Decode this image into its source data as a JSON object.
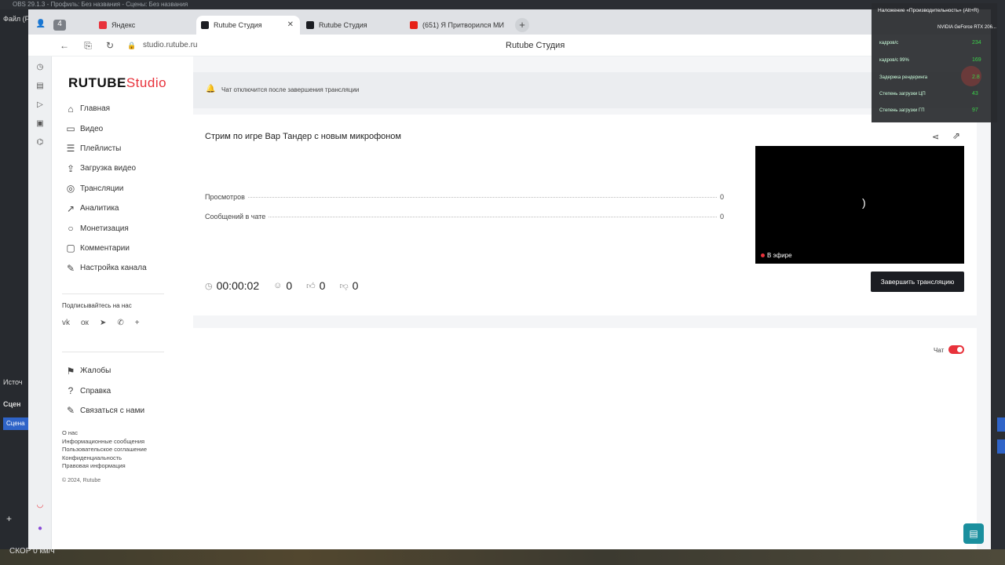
{
  "obs": {
    "title": "OBS 29.1.3 - Профиль: Без названия - Сцены: Без названия",
    "menu": "Файл (F)",
    "sources_label": "Источ",
    "scenes_label": "Сцен",
    "scene_button": "Сцена",
    "bottom_text": "СКОР 0 км/ч"
  },
  "browser": {
    "tabs": [
      {
        "label": "Яндекс",
        "active": false
      },
      {
        "label": "Rutube Студия",
        "active": true,
        "close": "✕"
      },
      {
        "label": "Rutube Студия",
        "active": false
      },
      {
        "label": "(651) Я Притворился МИ",
        "active": false
      }
    ],
    "newtab": "+",
    "url": "studio.rutube.ru",
    "page_title": "Rutube Студия"
  },
  "app": {
    "logo_main": "RUTUBE",
    "logo_accent": "Studio",
    "nav": [
      {
        "label": "Главная",
        "icon": "home-icon"
      },
      {
        "label": "Видео",
        "icon": "video-icon"
      },
      {
        "label": "Плейлисты",
        "icon": "playlist-icon"
      },
      {
        "label": "Загрузка видео",
        "icon": "upload-icon"
      },
      {
        "label": "Трансляции",
        "icon": "broadcast-icon"
      },
      {
        "label": "Аналитика",
        "icon": "analytics-icon"
      },
      {
        "label": "Монетизация",
        "icon": "monetization-icon"
      },
      {
        "label": "Комментарии",
        "icon": "comments-icon"
      },
      {
        "label": "Настройка канала",
        "icon": "settings-icon"
      }
    ],
    "follow_label": "Подписывайтесь на нас",
    "nav2": [
      {
        "label": "Жалобы",
        "icon": "flag-icon"
      },
      {
        "label": "Справка",
        "icon": "help-icon"
      },
      {
        "label": "Связаться с нами",
        "icon": "contact-icon"
      }
    ],
    "footer_links": [
      "О нас",
      "Информационные сообщения",
      "Пользовательское соглашение",
      "Конфиденциальность",
      "Правовая информация"
    ],
    "copyright": "© 2024, Rutube"
  },
  "main": {
    "notice": "Чат отключится после завершения трансляции",
    "stream_title": "Стрим по игре Вар Тандер с новым микрофоном",
    "stats": [
      {
        "label": "Просмотров",
        "value": "0"
      },
      {
        "label": "Сообщений в чате",
        "value": "0"
      }
    ],
    "live_label": "В эфире",
    "duration": "00:00:02",
    "viewers": "0",
    "likes": "0",
    "dislikes": "0",
    "end_button": "Завершить трансляцию",
    "chat_label": "Чат",
    "chat_enabled": true
  },
  "overlay": {
    "header": "Наложение «Производительность» (Alt+R)",
    "gpu": "NVIDIA GeForce RTX 206...",
    "metrics": [
      {
        "label": "кадров/с",
        "value": "234"
      },
      {
        "label": "кадров/с 99%",
        "value": "169"
      },
      {
        "label": "Задержка рендеринга",
        "value": "2.8"
      },
      {
        "label": "Степень загрузки ЦП",
        "value": "43"
      },
      {
        "label": "Степень загрузки ГП",
        "value": "97"
      }
    ]
  },
  "colors": {
    "accent": "#e8323b",
    "button_dark": "#1b1d22",
    "fab": "#1a8f9e"
  }
}
